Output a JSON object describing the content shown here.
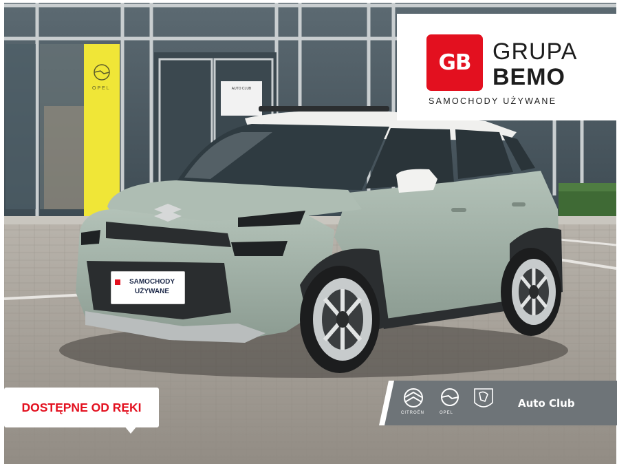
{
  "image": {
    "description_tags": [
      "car-photo",
      "dealer-listing"
    ],
    "overlays": {
      "brand": {
        "logo_text": "GB",
        "name_line1": "GRUPA",
        "name_line2": "BEMO",
        "subtitle": "SAMOCHODY UŻYWANE",
        "logo_color": "#e3101f"
      },
      "plate": {
        "line1": "SAMOCHODY",
        "line2": "UŻYWANE"
      },
      "availability_badge": {
        "text": "DOSTĘPNE OD RĘKI",
        "color": "#e3101f"
      },
      "auto_club": {
        "label": "Auto Club",
        "brands": [
          "CITROËN",
          "OPEL",
          "PEUGEOT"
        ],
        "bar_color": "#6e7478"
      },
      "showroom": {
        "pillar_text": "OPEL",
        "door_sign": "AUTO CLUB"
      }
    },
    "colors": {
      "car_body": "#a3b3a8",
      "car_roof": "#f0f0ee",
      "pavement": "#a19b93",
      "opel_yellow": "#f0e637",
      "glass": "#3d4a52"
    }
  }
}
